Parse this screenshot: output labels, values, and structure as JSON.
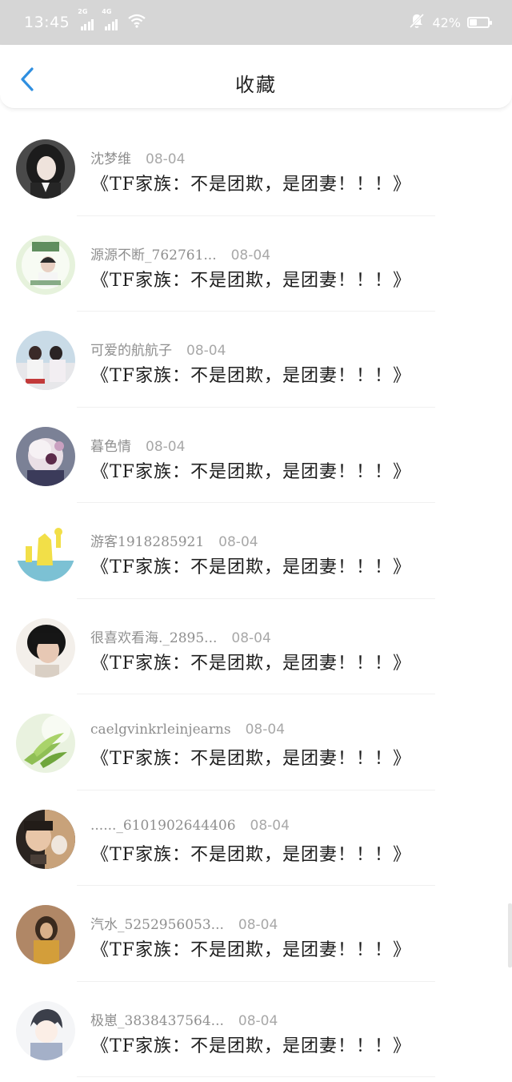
{
  "status_bar": {
    "time": "13:45",
    "signal1_label": "2G",
    "signal2_label": "4G",
    "battery": "42%",
    "battery_level": 0.42
  },
  "header": {
    "title": "收藏"
  },
  "colors": {
    "accent": "#2f8fe0",
    "status_bar_bg": "#d6d6d6"
  },
  "items": [
    {
      "user": "沈梦维",
      "date": "08-04",
      "title": "《TF家族：不是团欺，是团妻！！！》",
      "avatar": "avatar-1"
    },
    {
      "user": "源源不断_762761...",
      "date": "08-04",
      "title": "《TF家族：不是团欺，是团妻！！！》",
      "avatar": "avatar-2"
    },
    {
      "user": "可爱的航航子",
      "date": "08-04",
      "title": "《TF家族：不是团欺，是团妻！！！》",
      "avatar": "avatar-3"
    },
    {
      "user": "暮色情",
      "date": "08-04",
      "title": "《TF家族：不是团欺，是团妻！！！》",
      "avatar": "avatar-4"
    },
    {
      "user": "游客1918285921",
      "date": "08-04",
      "title": "《TF家族：不是团欺，是团妻！！！》",
      "avatar": "avatar-5"
    },
    {
      "user": "很喜欢看海._2895...",
      "date": "08-04",
      "title": "《TF家族：不是团欺，是团妻！！！》",
      "avatar": "avatar-6"
    },
    {
      "user": "caelgvinkrleinjearns",
      "date": "08-04",
      "title": "《TF家族：不是团欺，是团妻！！！》",
      "avatar": "avatar-7"
    },
    {
      "user": "......_6101902644406",
      "date": "08-04",
      "title": "《TF家族：不是团欺，是团妻！！！》",
      "avatar": "avatar-8"
    },
    {
      "user": "汽水_5252956053...",
      "date": "08-04",
      "title": "《TF家族：不是团欺，是团妻！！！》",
      "avatar": "avatar-9"
    },
    {
      "user": "极崽_3838437564...",
      "date": "08-04",
      "title": "《TF家族：不是团欺，是团妻！！！》",
      "avatar": "avatar-10"
    }
  ]
}
